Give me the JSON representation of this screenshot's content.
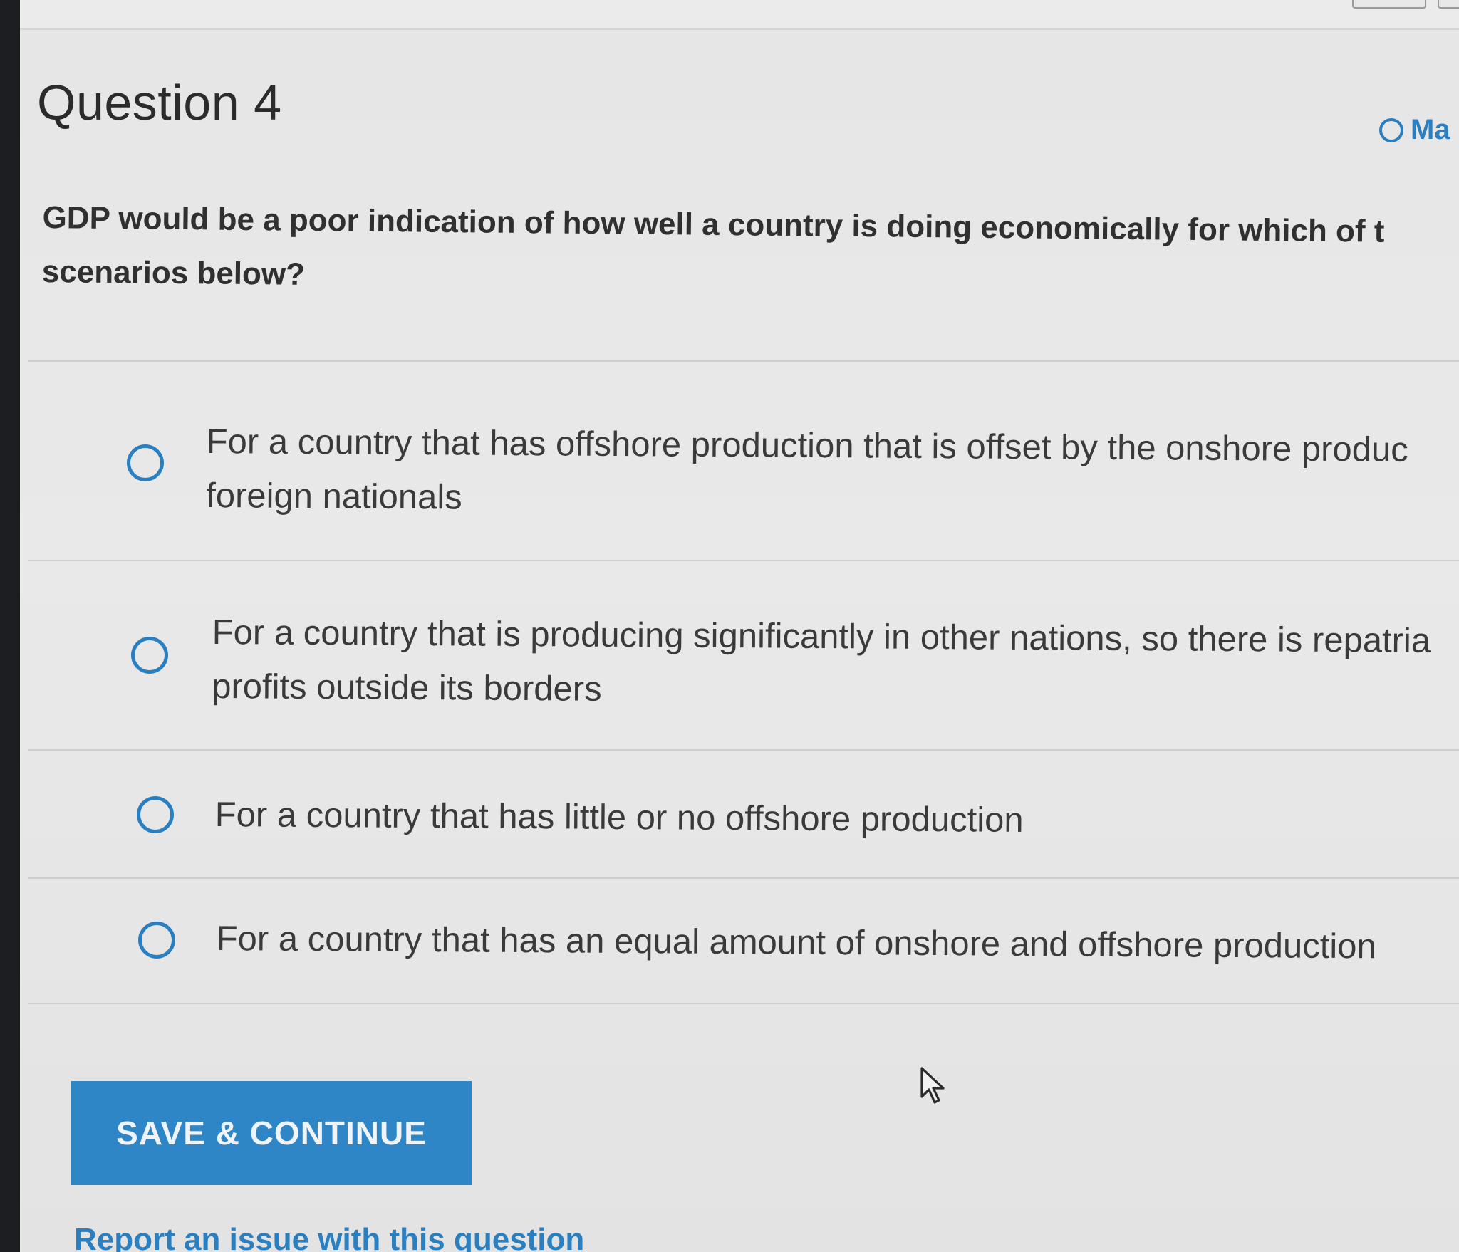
{
  "question": {
    "title": "Question 4",
    "mark_label": "Ma",
    "prompt": "GDP would be a poor indication of how well a country is doing economically for which of t\nscenarios below?"
  },
  "choices": [
    {
      "text": "For a country that has offshore production that is offset by the onshore produc\nforeign nationals",
      "selected": false
    },
    {
      "text": "For a country that is producing significantly in other nations, so there is repatria\nprofits outside its borders",
      "selected": false
    },
    {
      "text": "For a country that has little or no offshore production",
      "selected": false
    },
    {
      "text": "For a country that has an equal amount of onshore and offshore production",
      "selected": false
    }
  ],
  "actions": {
    "save_label": "SAVE & CONTINUE",
    "report_label": "Report an issue with this question"
  },
  "colors": {
    "accent": "#2a7fc1",
    "button_bg": "#2f86c6",
    "text": "#3a3a3a"
  },
  "icons": {
    "mark": "circle-outline-icon",
    "choice": "radio-circle-icon",
    "pointer": "cursor-arrow-icon"
  }
}
